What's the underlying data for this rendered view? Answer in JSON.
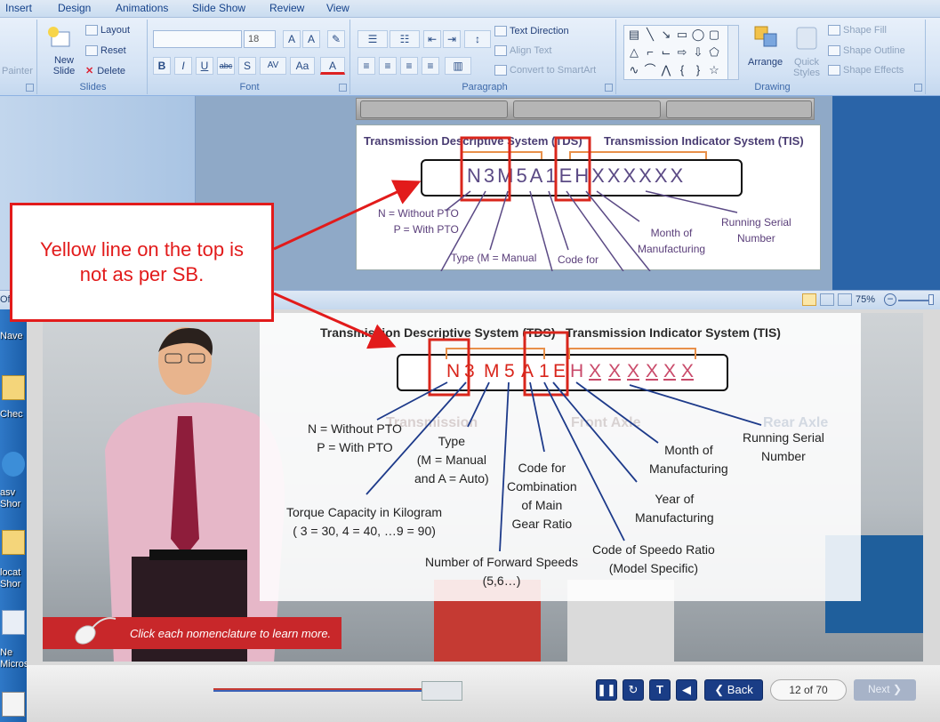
{
  "menu": [
    "Insert",
    "Design",
    "Animations",
    "Slide Show",
    "Review",
    "View"
  ],
  "ribbon": {
    "clipboard": {
      "painter": "Painter"
    },
    "slides": {
      "label": "Slides",
      "new_slide": "New Slide",
      "layout": "Layout",
      "reset": "Reset",
      "delete": "Delete"
    },
    "font": {
      "label": "Font",
      "size": "18"
    },
    "paragraph": {
      "label": "Paragraph",
      "text_direction": "Text Direction",
      "align_text": "Align Text",
      "convert": "Convert to SmartArt"
    },
    "drawing": {
      "label": "Drawing",
      "arrange": "Arrange",
      "quick_styles": "Quick Styles",
      "shape_fill": "Shape Fill",
      "shape_outline": "Shape Outline",
      "shape_effects": "Shape Effects"
    }
  },
  "editor_slide": {
    "tds_title": "Transmission Descriptive System (TDS)",
    "tis_title": "Transmission Indicator System (TIS)",
    "code": "N3M5A1EHXXXXXX",
    "pto": "N = Without  PTO\nP = With PTO",
    "type": "Type (M = Manual",
    "type2": "and A = Auto)",
    "code_for": "Code for",
    "month": "Month of\nManufacturing",
    "serial": "Running Serial\nNumber"
  },
  "status": {
    "zoom": "75%"
  },
  "callout": {
    "text": "Yellow line on the top is\nnot as per SB."
  },
  "desktop_labels": [
    "Nave",
    "Chec",
    "asv\nShor",
    "locat\nShor",
    "Ne\nMicros"
  ],
  "player": {
    "tds_title": "Transmission Descriptive System (TDS)",
    "tis_title": "Transmission Indicator System (TIS)",
    "code_chars": [
      "N",
      "3",
      "M",
      "5",
      "A",
      "1",
      "E",
      "H",
      "X",
      "X",
      "X",
      "X",
      "X",
      "X"
    ],
    "labels": {
      "pto": "N = Without PTO\nP = With PTO",
      "type": "Type\n(M = Manual\nand A = Auto)",
      "torque": "Torque Capacity in Kilogram\n( 3 = 30, 4 = 40, …9 = 90)",
      "forward": "Number of Forward Speeds\n(5,6…)",
      "combination": "Code for\nCombination\nof Main\nGear Ratio",
      "speedo": "Code of Speedo Ratio\n(Model Specific)",
      "year": "Year of\nManufacturing",
      "month": "Month of\nManufacturing",
      "serial": "Running Serial\nNumber"
    },
    "bg_labels": {
      "transmission": "Transmission",
      "front_axle": "Front Axle",
      "rear_axle": "Rear Axle"
    },
    "instruction": "Click each nomenclature to learn more.",
    "back": "Back",
    "page": "12 of 70",
    "next": "Next"
  },
  "colors": {
    "callout_red": "#e21b1b",
    "code_red": "#d9261c",
    "bracket_orange": "#e8904a",
    "nav_blue": "#1a3d86"
  }
}
